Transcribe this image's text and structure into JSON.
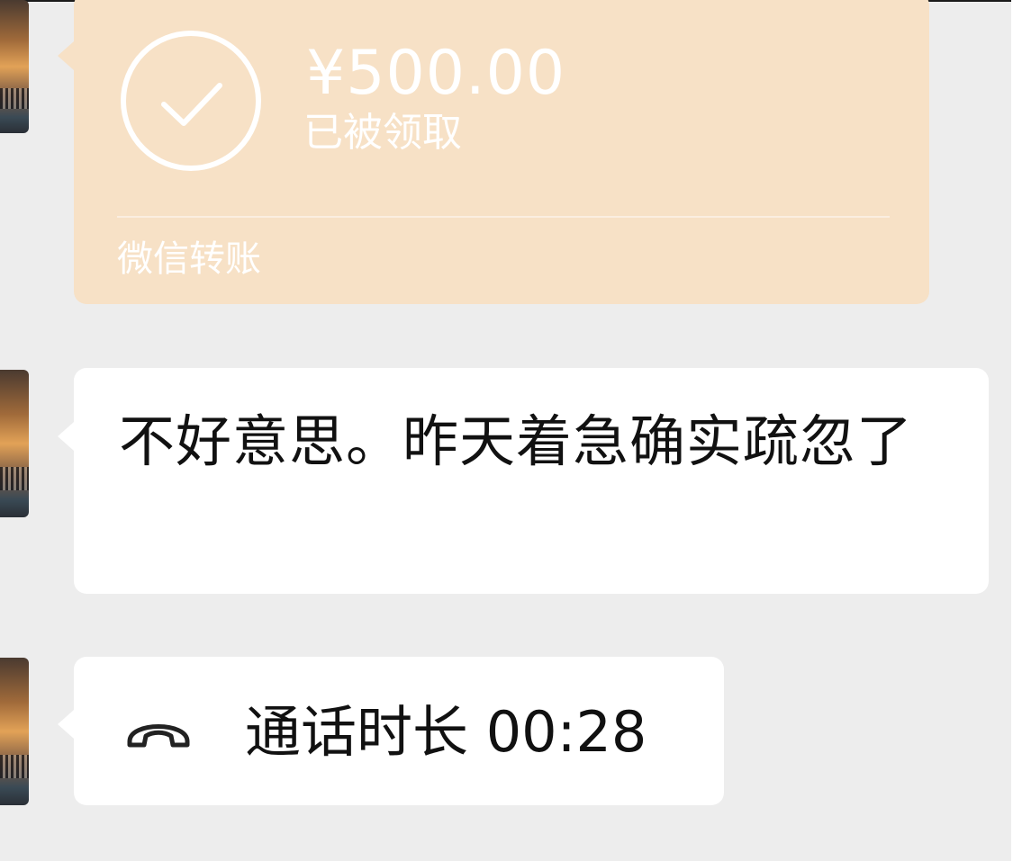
{
  "transfer": {
    "amount": "¥500.00",
    "status": "已被领取",
    "label": "微信转账"
  },
  "message": {
    "text": "不好意思。昨天着急确实疏忽了"
  },
  "call": {
    "text": "通话时长 00:28"
  },
  "icons": {
    "transfer_status": "checkmark-circle-icon",
    "call": "phone-handset-icon"
  },
  "colors": {
    "background": "#ededed",
    "transfer_card": "#f7e1c6",
    "bubble": "#ffffff",
    "text": "#111111"
  }
}
